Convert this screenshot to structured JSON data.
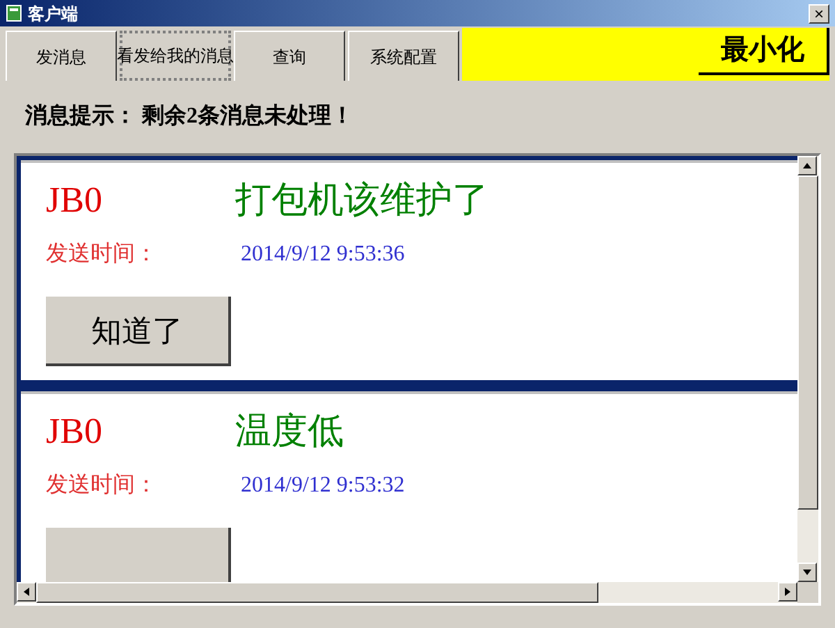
{
  "window": {
    "title": "客户端",
    "close": "×"
  },
  "tabs": [
    {
      "label": "发消息",
      "selected": false
    },
    {
      "label": "看发给我的消息",
      "selected": true
    },
    {
      "label": "查询",
      "selected": false
    },
    {
      "label": "系统配置",
      "selected": false
    }
  ],
  "minimize_button": "最小化",
  "notice": "消息提示： 剩余2条消息未处理！",
  "messages": [
    {
      "sender": "JB0",
      "content": "打包机该维护了",
      "time_label": "发送时间：",
      "time": "2014/9/12 9:53:36",
      "button": "知道了"
    },
    {
      "sender": "JB0",
      "content": "温度低",
      "time_label": "发送时间：",
      "time": "2014/9/12 9:53:32"
    }
  ]
}
